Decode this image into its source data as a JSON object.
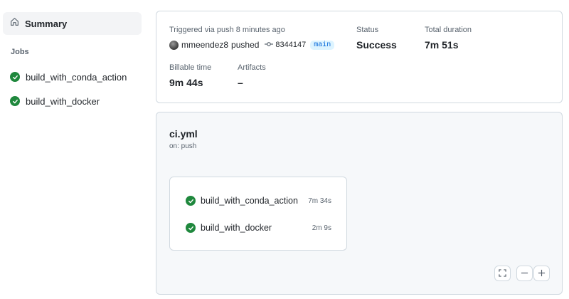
{
  "sidebar": {
    "summary_label": "Summary",
    "jobs_title": "Jobs",
    "jobs": [
      {
        "label": "build_with_conda_action",
        "status": "success"
      },
      {
        "label": "build_with_docker",
        "status": "success"
      }
    ]
  },
  "run": {
    "triggered_text": "Triggered via push 8 minutes ago",
    "actor": "mmeendez8",
    "action": "pushed",
    "commit_sha": "8344147",
    "branch": "main",
    "status_label": "Status",
    "status_value": "Success",
    "duration_label": "Total duration",
    "duration_value": "7m 51s",
    "billable_label": "Billable time",
    "billable_value": "9m 44s",
    "artifacts_label": "Artifacts",
    "artifacts_value": "–"
  },
  "workflow": {
    "file": "ci.yml",
    "trigger": "on: push",
    "jobs": [
      {
        "label": "build_with_conda_action",
        "duration": "7m 34s"
      },
      {
        "label": "build_with_docker",
        "duration": "2m 9s"
      }
    ]
  },
  "colors": {
    "success": "#1f883d",
    "branch_bg": "#ddf4ff",
    "branch_fg": "#0969da"
  }
}
